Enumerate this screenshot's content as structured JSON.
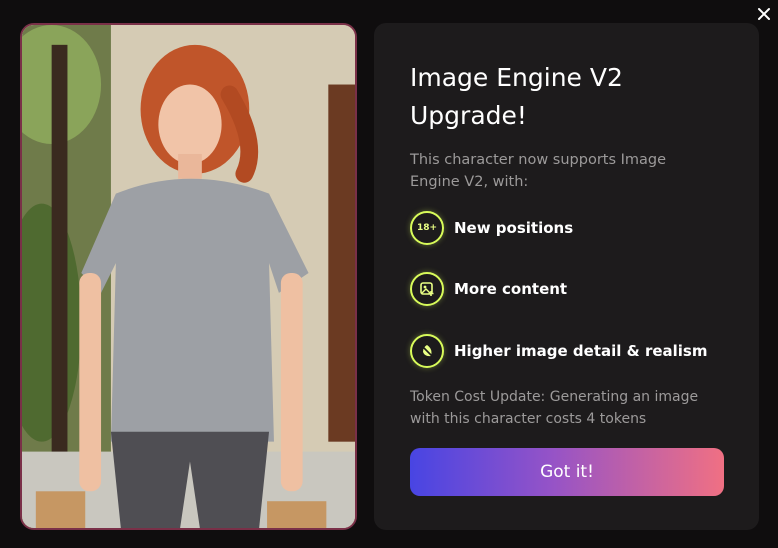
{
  "modal": {
    "close_label": "✕",
    "title": "Image Engine V2 Upgrade!",
    "intro": "This character now supports Image Engine V2, with:",
    "features": [
      {
        "badge": "18+",
        "label": "New positions",
        "icon": "age-18plus-icon"
      },
      {
        "badge": "",
        "label": "More content",
        "icon": "image-plus-icon"
      },
      {
        "badge": "",
        "label": "Higher image detail & realism",
        "icon": "leaf-detail-icon"
      }
    ],
    "note": "Token Cost Update: Generating an image with this character costs 4 tokens",
    "cta_label": "Got it!"
  },
  "colors": {
    "accent_lime": "#d8fb5a",
    "cta_gradient_start": "#4845e3",
    "cta_gradient_end": "#f07083",
    "panel_bg": "#1d1b1c",
    "page_bg": "#0f0d0e"
  }
}
